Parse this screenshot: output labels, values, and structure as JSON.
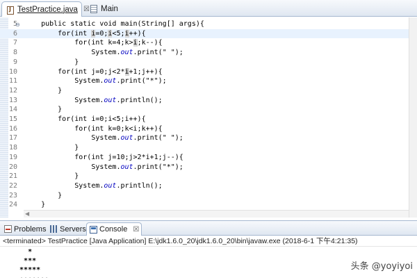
{
  "editor_tabs": [
    {
      "label": "TestPractice.java",
      "close": "☒"
    },
    {
      "label": "Main"
    }
  ],
  "code_lines": [
    {
      "num": "5",
      "text": "    public static void main(String[] args){"
    },
    {
      "num": "6",
      "text": "        for(int i=0;i<5;i++){"
    },
    {
      "num": "7",
      "text": "            for(int k=4;k>i;k--){"
    },
    {
      "num": "8",
      "text": "                System.out.print(\" \");"
    },
    {
      "num": "9",
      "text": "            }"
    },
    {
      "num": "10",
      "text": "        for(int j=0;j<2*i+1;j++){"
    },
    {
      "num": "11",
      "text": "            System.out.print(\"*\");"
    },
    {
      "num": "12",
      "text": "        }"
    },
    {
      "num": "13",
      "text": "            System.out.println();"
    },
    {
      "num": "14",
      "text": "        }"
    },
    {
      "num": "15",
      "text": "        for(int i=0;i<5;i++){"
    },
    {
      "num": "16",
      "text": "            for(int k=0;k<i;k++){"
    },
    {
      "num": "17",
      "text": "                System.out.print(\" \");"
    },
    {
      "num": "18",
      "text": "            }"
    },
    {
      "num": "19",
      "text": "            for(int j=10;j>2*i+1;j--){"
    },
    {
      "num": "20",
      "text": "                System.out.print(\"*\");"
    },
    {
      "num": "21",
      "text": "            }"
    },
    {
      "num": "22",
      "text": "            System.out.println();"
    },
    {
      "num": "23",
      "text": "        }"
    },
    {
      "num": "24",
      "text": "    }"
    }
  ],
  "panel_tabs": [
    {
      "label": "Problems"
    },
    {
      "label": "Servers"
    },
    {
      "label": "Console",
      "close": "☒"
    }
  ],
  "console": {
    "terminated": "<terminated> TestPractice [Java Application] E:\\jdk1.6.0_20\\jdk1.6.0_20\\bin\\javaw.exe (2018-6-1 下午4:21:35)",
    "output": [
      "    *",
      "   ***",
      "  *****",
      "  ·······"
    ]
  },
  "watermark": "头条 @yoyiyoi",
  "colors": {
    "current_line": "#e8f2fe",
    "occurrence_highlight": "#d4d4d4",
    "static_field": "#0000c0"
  }
}
